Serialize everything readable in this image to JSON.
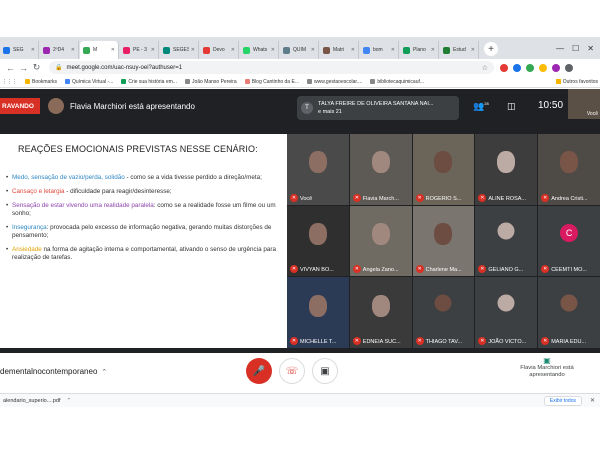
{
  "browser": {
    "tabs": [
      {
        "label": "SEG",
        "color": "#1a73e8"
      },
      {
        "label": "2ºD4",
        "color": "#9c27b0"
      },
      {
        "label": "M",
        "color": "#34a853"
      },
      {
        "label": "PE - 3",
        "color": "#e91e63"
      },
      {
        "label": "SEGES",
        "color": "#00897b"
      },
      {
        "label": "Devo",
        "color": "#e53935"
      },
      {
        "label": "Whats",
        "color": "#25d366"
      },
      {
        "label": "QUÍM",
        "color": "#607d8b"
      },
      {
        "label": "Matri",
        "color": "#795548"
      },
      {
        "label": "bom",
        "color": "#4285f4"
      },
      {
        "label": "Plano",
        "color": "#0f9d58"
      },
      {
        "label": "Estud",
        "color": "#1e7e34"
      }
    ],
    "active_tab_index": 2,
    "new_tab_symbol": "+",
    "window_controls": [
      "—",
      "☐",
      "✕"
    ],
    "url": "meet.google.com/uac-nsuy-oei?authuser=1",
    "bookmarks": [
      {
        "label": "Bookmarks",
        "color": "#f4b400"
      },
      {
        "label": "Química Virtual -...",
        "color": "#4285f4"
      },
      {
        "label": "Crie sua história em...",
        "color": "#0f9d58"
      },
      {
        "label": "João Manso Pereira",
        "color": "#888888"
      },
      {
        "label": "Blog Cantinho da E...",
        "color": "#e67c73"
      },
      {
        "label": "www.gestaoescolar....",
        "color": "#888888"
      },
      {
        "label": "bibliotecaquimicauf...",
        "color": "#888888"
      }
    ],
    "bookmarks_other": "Outros favoritos"
  },
  "meet": {
    "recording_label": "RAVANDO",
    "presenter_text": "Flavia Marchiori está apresentando",
    "pinned_name": "TALYA FREIRE DE OLIVEIRA SANTANA NAI...",
    "pinned_extra": "e mais 21",
    "pinned_initial": "T",
    "people_count": "28",
    "time": "10:50",
    "self_label": "Você",
    "slide": {
      "title": "REAÇÕES EMOCIONAIS PREVISTAS NESSE CENÁRIO:",
      "items": [
        {
          "key": "Medo, sensação de vazio/perda, solidão",
          "rest": " - como se a vida tivesse perdido a direção/meta;"
        },
        {
          "key": "Cansaço e letargia",
          "rest": " - dificuldade para reagir/desinteresse;"
        },
        {
          "key": "Sensação de estar vivendo uma realidade paralela",
          "rest": ": como se a realidade fosse um filme ou um sonho;"
        },
        {
          "key": "Insegurança",
          "rest": ": provocada pelo excesso de informação negativa, gerando muitas distorções de pensamento;"
        },
        {
          "key": "Ansiedade",
          "rest": " na forma de agitação interna e comportamental, ativando o senso de urgência para realização de tarefas."
        }
      ]
    },
    "participants": [
      {
        "name": "Você",
        "bg": "#4a4a4a",
        "kind": "face"
      },
      {
        "name": "Flavia March...",
        "bg": "#5d5a55",
        "kind": "face"
      },
      {
        "name": "ROGERIO S...",
        "bg": "#6b6459",
        "kind": "face"
      },
      {
        "name": "ALINE ROSA...",
        "bg": "#3d3d3d",
        "kind": "face"
      },
      {
        "name": "Andrea Cristi...",
        "bg": "#4e4a46",
        "kind": "face"
      },
      {
        "name": "VIVYAN BO...",
        "bg": "#2f2f2f",
        "kind": "face"
      },
      {
        "name": "Angela Zano...",
        "bg": "#6f6a62",
        "kind": "face"
      },
      {
        "name": "Charlene Ma...",
        "bg": "#7a756f",
        "kind": "face"
      },
      {
        "name": "GELIANO G...",
        "bg": "#3c4043",
        "kind": "round"
      },
      {
        "name": "CEEMTI MO...",
        "bg": "#3c4043",
        "kind": "initial",
        "initial": "C"
      },
      {
        "name": "MICHELLE T...",
        "bg": "#2b3a55",
        "kind": "face"
      },
      {
        "name": "EDNEIA SUC...",
        "bg": "#3a3a3a",
        "kind": "face"
      },
      {
        "name": "THIAGO TAV...",
        "bg": "#3c4043",
        "kind": "round"
      },
      {
        "name": "JOÃO VICTO...",
        "bg": "#3c4043",
        "kind": "round"
      },
      {
        "name": "MARIA EDU...",
        "bg": "#3c4043",
        "kind": "round"
      }
    ],
    "meeting_name": "dementalnocontemporaneo",
    "presenting_label": "Flavia Marchiori está apresentando"
  },
  "downloads": {
    "file": "alendario_superio....pdf",
    "show_all": "Exibir todos"
  }
}
